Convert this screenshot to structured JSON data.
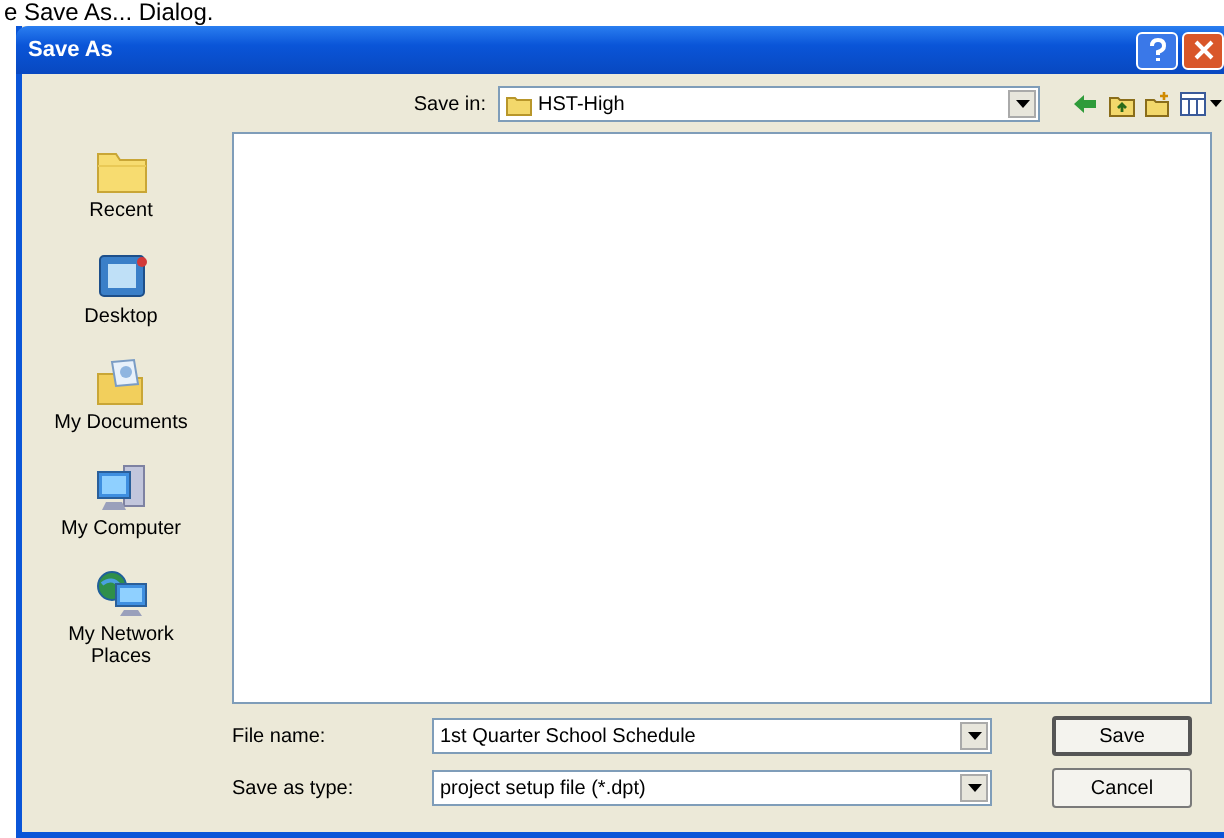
{
  "caption": "e Save As... Dialog.",
  "window": {
    "title": "Save As"
  },
  "save_in": {
    "label": "Save in:",
    "value": "HST-High"
  },
  "places": [
    {
      "label": "Recent",
      "kind": "recent"
    },
    {
      "label": "Desktop",
      "kind": "desktop"
    },
    {
      "label": "My Documents",
      "kind": "documents"
    },
    {
      "label": "My Computer",
      "kind": "computer"
    },
    {
      "label": "My Network Places",
      "kind": "network"
    }
  ],
  "file_name": {
    "label": "File name:",
    "value": "1st Quarter School Schedule"
  },
  "save_as_type": {
    "label": "Save as type:",
    "value": "project setup file (*.dpt)"
  },
  "buttons": [
    {
      "label": "Save",
      "kind": "default"
    },
    {
      "label": "Cancel",
      "kind": "normal"
    }
  ]
}
